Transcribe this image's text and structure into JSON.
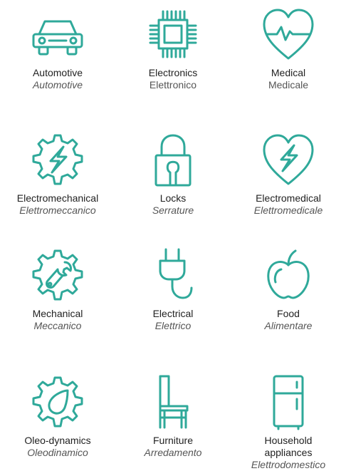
{
  "accent_color": "#2fa99a",
  "items": [
    {
      "icon": "car-icon",
      "en": "Automotive",
      "it": "Automotive"
    },
    {
      "icon": "chip-icon",
      "en": "Electronics",
      "it": "Elettronico"
    },
    {
      "icon": "heart-pulse-icon",
      "en": "Medical",
      "it": "Medicale"
    },
    {
      "icon": "gear-lightning-icon",
      "en": "Electromechanical",
      "it": "Elettromeccanico"
    },
    {
      "icon": "padlock-icon",
      "en": "Locks",
      "it": "Serrature"
    },
    {
      "icon": "heart-lightning-icon",
      "en": "Electromedical",
      "it": "Elettromedicale"
    },
    {
      "icon": "gear-wrench-icon",
      "en": "Mechanical",
      "it": "Meccanico"
    },
    {
      "icon": "plug-icon",
      "en": "Electrical",
      "it": "Elettrico"
    },
    {
      "icon": "apple-icon",
      "en": "Food",
      "it": "Alimentare"
    },
    {
      "icon": "gear-drop-icon",
      "en": "Oleo-dynamics",
      "it": "Oleodinamico"
    },
    {
      "icon": "chair-icon",
      "en": "Furniture",
      "it": "Arredamento"
    },
    {
      "icon": "fridge-icon",
      "en": "Household appliances",
      "it": "Elettrodomestico"
    }
  ]
}
